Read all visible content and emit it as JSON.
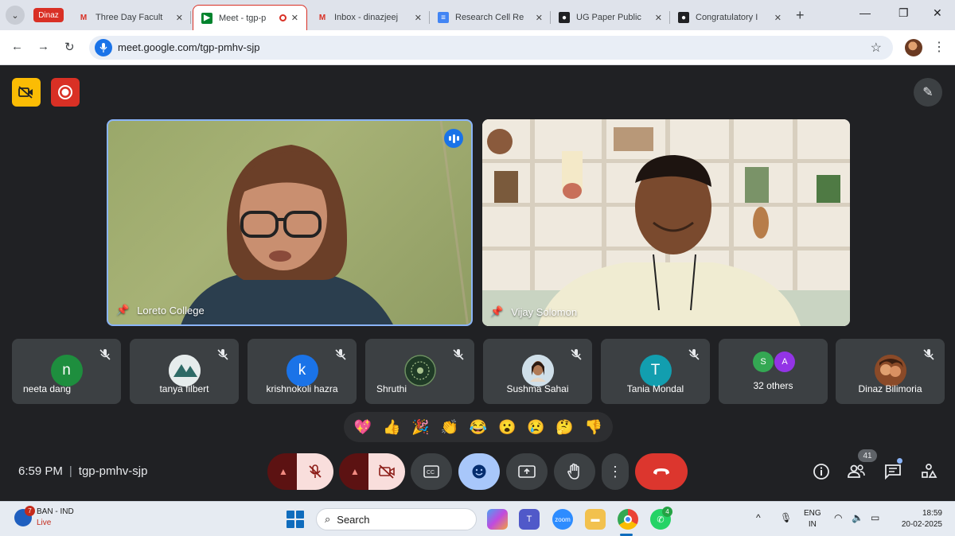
{
  "browser": {
    "profile_chip": "Dinaz",
    "tabs": [
      {
        "title": "Three Day Facult",
        "icon": "gmail-icon"
      },
      {
        "title": "Meet - tgp-p",
        "icon": "meet-icon",
        "active": true
      },
      {
        "title": "Inbox - dinazjeej",
        "icon": "gmail-icon"
      },
      {
        "title": "Research Cell Re",
        "icon": "docs-icon"
      },
      {
        "title": "UG Paper Public",
        "icon": "notion-icon"
      },
      {
        "title": "Congratulatory I",
        "icon": "notion-icon"
      }
    ],
    "url": "meet.google.com/tgp-pmhv-sjp"
  },
  "meeting": {
    "time": "6:59 PM",
    "code": "tgp-pmhv-sjp",
    "participants_count": "41",
    "main_videos": [
      {
        "name": "Loreto College",
        "speaking": true
      },
      {
        "name": "Vijay Solomon",
        "speaking": false
      }
    ],
    "tiles": [
      {
        "name": "neeta dang",
        "initial": "n",
        "color": "#1e8e3e",
        "type": "letter"
      },
      {
        "name": "tanya filbert",
        "type": "photo"
      },
      {
        "name": "krishnokoli hazra",
        "initial": "k",
        "color": "#1a73e8",
        "type": "letter"
      },
      {
        "name": "Shruthi",
        "type": "photo"
      },
      {
        "name": "Sushma Sahai",
        "type": "photo"
      },
      {
        "name": "Tania Mondal",
        "initial": "T",
        "color": "#129eaf",
        "type": "letter"
      },
      {
        "name": "32 others",
        "type": "others",
        "avatars": [
          {
            "initial": "S",
            "color": "#34a853"
          },
          {
            "initial": "A",
            "color": "#9334e6"
          }
        ]
      },
      {
        "name": "Dinaz Bilimoria",
        "type": "photo"
      }
    ],
    "reactions": [
      "💖",
      "👍",
      "🎉",
      "👏",
      "😂",
      "😮",
      "😢",
      "🤔",
      "👎"
    ]
  },
  "taskbar": {
    "weather_line1": "BAN - IND",
    "weather_line2": "Live",
    "weather_badge": "7",
    "search_label": "Search",
    "whatsapp_badge": "4",
    "lang_line1": "ENG",
    "lang_line2": "IN",
    "time": "18:59",
    "date": "20-02-2025"
  }
}
